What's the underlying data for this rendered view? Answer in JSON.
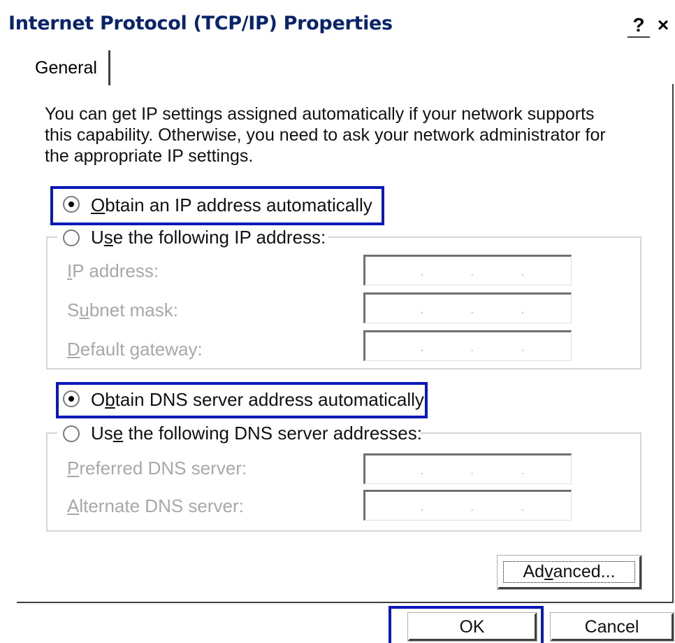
{
  "window": {
    "title": "Internet Protocol (TCP/IP) Properties",
    "help_label": "?",
    "close_label": "×"
  },
  "tabs": [
    {
      "label": "General"
    }
  ],
  "intro": {
    "line1": "You can get IP settings assigned automatically if your network supports",
    "line2": "this capability. Otherwise, you need to ask your network administrator for",
    "line3": "the appropriate IP settings."
  },
  "ip": {
    "auto_label_pre": "",
    "auto_label_key": "O",
    "auto_label_post": "btain an IP address automatically",
    "auto_selected": true,
    "manual_label_pre": "U",
    "manual_label_key": "s",
    "manual_label_post": "e the following IP address:",
    "manual_selected": false,
    "fields": [
      {
        "pre": "",
        "key": "I",
        "post": "P address:",
        "value": " .  .  . "
      },
      {
        "pre": "S",
        "key": "u",
        "post": "bnet mask:",
        "value": " .  .  . "
      },
      {
        "pre": "",
        "key": "D",
        "post": "efault gateway:",
        "value": " .  .  . "
      }
    ]
  },
  "dns": {
    "auto_label_pre": "O",
    "auto_label_key": "b",
    "auto_label_post": "tain DNS server address automatically",
    "auto_selected": true,
    "manual_label_pre": "Us",
    "manual_label_key": "e",
    "manual_label_post": " the following DNS server addresses:",
    "manual_selected": false,
    "fields": [
      {
        "pre": "",
        "key": "P",
        "post": "referred DNS server:"
      },
      {
        "pre": "",
        "key": "A",
        "post": "lternate DNS server:"
      }
    ]
  },
  "buttons": {
    "advanced_pre": "Ad",
    "advanced_key": "v",
    "advanced_post": "anced...",
    "ok_label": "OK",
    "cancel_label": "Cancel"
  },
  "colors": {
    "title": "#0a246a",
    "highlight": "#0a19b8",
    "disabled_text": "#a8a8a8"
  }
}
